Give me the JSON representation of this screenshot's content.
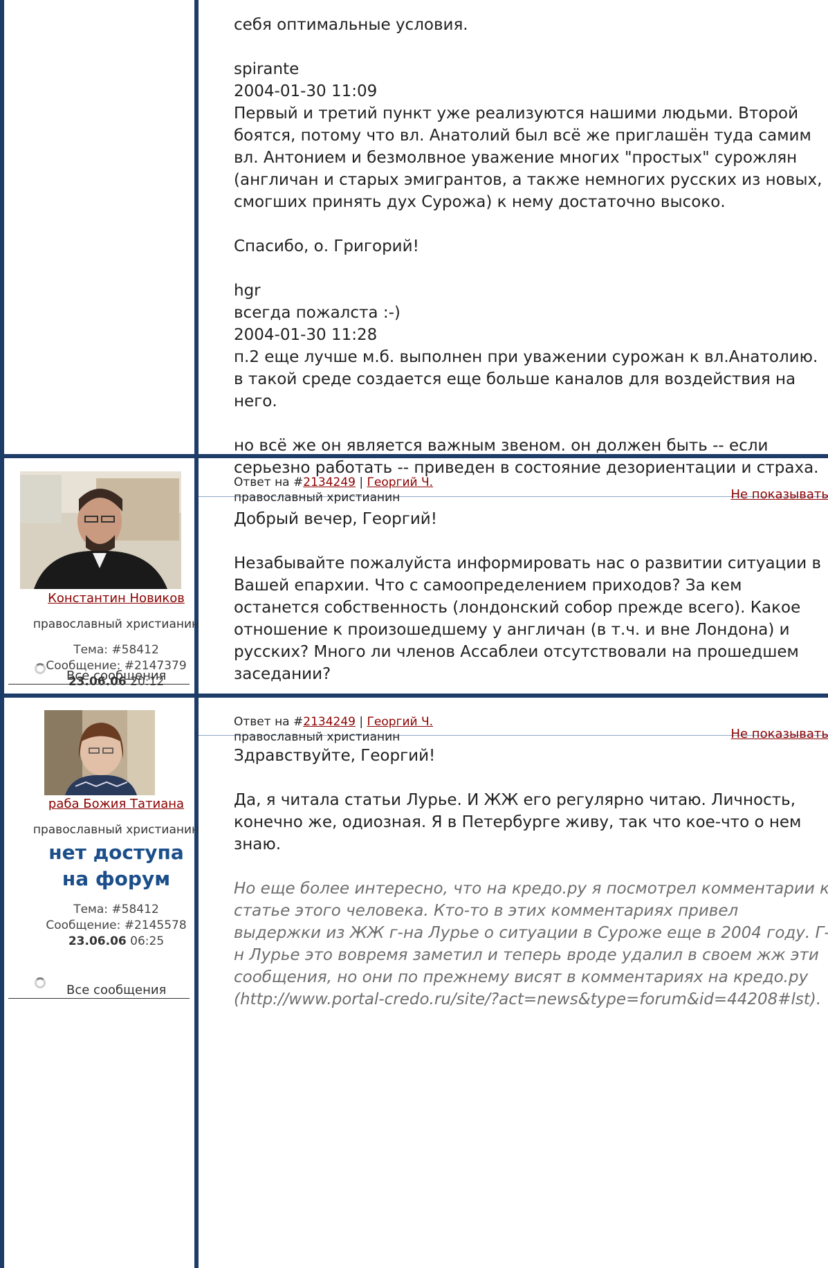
{
  "post1": {
    "paragraphs": [
      "себя оптимальные условия.",
      "spirante\n2004-01-30 11:09\nПервый и третий пункт уже реализуются нашими людьми. Второй боятся, потому что вл. Анатолий был всё же приглашён туда самим вл. Антонием и безмолвное уважение многих \"простых\" сурожлян (англичан и старых эмигрантов, а также немногих русских из новых, смогших принять дух Сурожа) к нему достаточно высоко.",
      "Спасибо, о. Григорий!",
      "hgr\nвсегда пожалста :-)\n2004-01-30 11:28\nп.2 еще лучше м.б. выполнен при уважении сурожан к вл.Анатолию. в такой среде создается еще больше каналов для воздействия на него.",
      "но всё же он является важным звеном. он должен быть -- если серьезно работать -- приведен в состояние дезориентации и страха."
    ]
  },
  "post2": {
    "reply_prefix": "Ответ на #",
    "reply_id": "2134249",
    "sep": " | ",
    "reply_author": "Георгий Ч.",
    "reply_role": " православный христианин",
    "hide_label": "Не показывать",
    "author_name": "Константин Новиков",
    "author_role": "православный христианин",
    "topic": "Тема: #58412",
    "message": "Сообщение: #2147379",
    "date": "23.06.06",
    "time": " 20:12",
    "all_messages": "Все сообщения",
    "paragraphs": [
      "Добрый вечер, Георгий!",
      "Незабывайте пожалуйста информировать нас о развитии ситуации в Вашей епархии. Что с самоопределением приходов? За кем останется собственность (лондонский собор прежде всего). Какое отношение к произошедшему у англичан (в т.ч. и вне Лондона) и русских? Много ли членов Ассаблеи отсутствовали на прошедшем заседании?"
    ]
  },
  "post3": {
    "reply_prefix": "Ответ на #",
    "reply_id": "2134249",
    "sep": " | ",
    "reply_author": "Георгий Ч.",
    "reply_role": " православный христианин",
    "hide_label": "Не показывать",
    "author_name": "раба Божия Татиана",
    "author_role": "православный христианин",
    "no_access": "нет доступа на форум",
    "topic": "Тема: #58412",
    "message": "Сообщение: #2145578",
    "date": "23.06.06",
    "time": " 06:25",
    "all_messages": "Все сообщения",
    "paragraphs": [
      "Здравствуйте, Георгий!",
      "Да, я читала статьи Лурье. И ЖЖ его регулярно читаю. Личность, конечно же, одиозная. Я в Петербурге живу, так что кое-что о нем знаю."
    ],
    "quote": "Но еще более интересно, что на кредо.ру я посмотрел комментарии к статье этого человека. Кто-то в этих комментариях привел выдержки из ЖЖ г-на Лурье о ситуации в Суроже еще в 2004 году. Г-н Лурье это вовремя заметил и теперь вроде удалил в своем жж эти сообщения, но они по прежнему висят в комментариях на кредо.ру (http://www.portal-credo.ru/site/?act=news&type=forum&id=44208#lst)."
  },
  "colors": {
    "frame": "#1e3c68",
    "link": "#8b0000",
    "no_access": "#1b4e8a",
    "quote": "#6e6e6e"
  },
  "icons": [
    "loading-spinner-icon"
  ]
}
